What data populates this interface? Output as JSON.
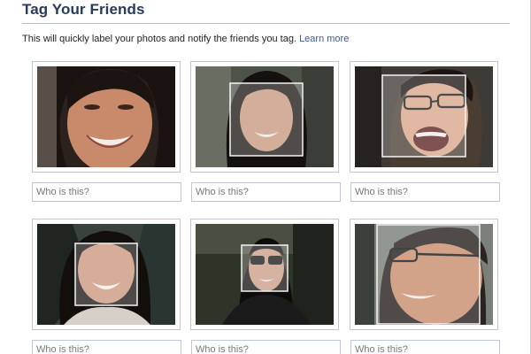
{
  "dialog": {
    "title": "Tag Your Friends",
    "subtitle": "This will quickly label your photos and notify the friends you tag.",
    "learn_more": "Learn more"
  },
  "faces": [
    {
      "placeholder": "Who is this?",
      "value": ""
    },
    {
      "placeholder": "Who is this?",
      "value": ""
    },
    {
      "placeholder": "Who is this?",
      "value": ""
    },
    {
      "placeholder": "Who is this?",
      "value": ""
    },
    {
      "placeholder": "Who is this?",
      "value": ""
    },
    {
      "placeholder": "Who is this?",
      "value": ""
    }
  ],
  "colors": {
    "title": "#283b5c",
    "link": "#3b5998",
    "input_border": "#bdc7d8"
  }
}
